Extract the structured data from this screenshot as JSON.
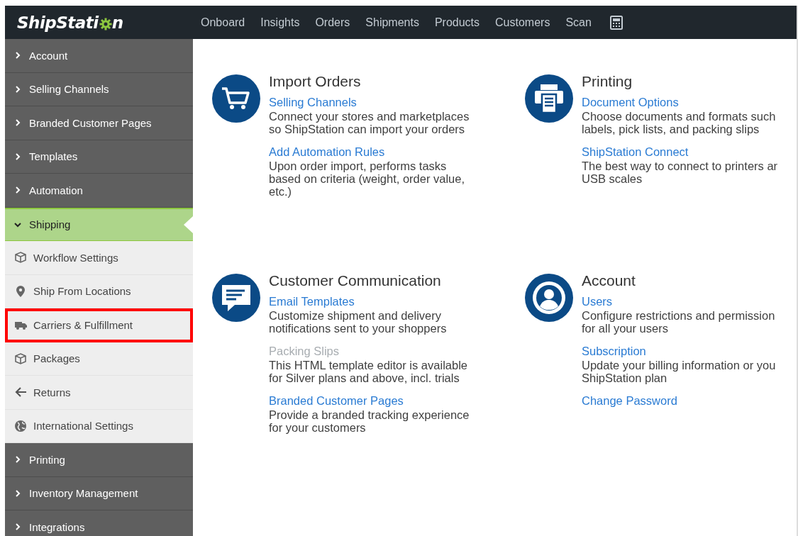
{
  "topbar": {
    "logo": {
      "before_gear": "ShipStati",
      "after_gear": "n"
    },
    "nav": [
      {
        "label": "Onboard"
      },
      {
        "label": "Insights"
      },
      {
        "label": "Orders"
      },
      {
        "label": "Shipments"
      },
      {
        "label": "Products"
      },
      {
        "label": "Customers"
      },
      {
        "label": "Scan"
      }
    ]
  },
  "sidebar": {
    "items": [
      {
        "label": "Account",
        "expanded": false
      },
      {
        "label": "Selling Channels",
        "expanded": false
      },
      {
        "label": "Branded Customer Pages",
        "expanded": false
      },
      {
        "label": "Templates",
        "expanded": false
      },
      {
        "label": "Automation",
        "expanded": false
      },
      {
        "label": "Shipping",
        "expanded": true,
        "children": [
          {
            "label": "Workflow Settings",
            "highlighted": false
          },
          {
            "label": "Ship From Locations",
            "highlighted": false
          },
          {
            "label": "Carriers & Fulfillment",
            "highlighted": true
          },
          {
            "label": "Packages",
            "highlighted": false
          },
          {
            "label": "Returns",
            "highlighted": false
          },
          {
            "label": "International Settings",
            "highlighted": false
          }
        ]
      },
      {
        "label": "Printing",
        "expanded": false
      },
      {
        "label": "Inventory Management",
        "expanded": false
      },
      {
        "label": "Integrations",
        "expanded": false
      }
    ]
  },
  "sections": [
    {
      "title": "Import Orders",
      "links": [
        {
          "label": "Selling Channels",
          "disabled": false,
          "description": [
            "Connect your stores and marketplaces",
            "so ShipStation can import your orders"
          ]
        },
        {
          "label": "Add Automation Rules",
          "disabled": false,
          "description": [
            "Upon order import, performs tasks",
            "based on criteria (weight, order value,",
            "etc.)"
          ]
        }
      ]
    },
    {
      "title": "Printing",
      "links": [
        {
          "label": "Document Options",
          "disabled": false,
          "description": [
            "Choose documents and formats such",
            "labels, pick lists, and packing slips"
          ]
        },
        {
          "label": "ShipStation Connect",
          "disabled": false,
          "description": [
            "The best way to connect to printers ar",
            "USB scales"
          ]
        }
      ]
    },
    {
      "title": "Customer Communication",
      "links": [
        {
          "label": "Email Templates",
          "disabled": false,
          "description": [
            "Customize shipment and delivery",
            "notifications sent to your shoppers"
          ]
        },
        {
          "label": "Packing Slips",
          "disabled": true,
          "description": [
            "This HTML template editor is available",
            "for Silver plans and above, incl. trials"
          ]
        },
        {
          "label": "Branded Customer Pages",
          "disabled": false,
          "description": [
            "Provide a branded tracking experience",
            "for your customers"
          ]
        }
      ]
    },
    {
      "title": "Account",
      "links": [
        {
          "label": "Users",
          "disabled": false,
          "description": [
            "Configure restrictions and permission",
            "for all your users"
          ]
        },
        {
          "label": "Subscription",
          "disabled": false,
          "description": [
            "Update your billing information or you",
            "ShipStation plan"
          ]
        },
        {
          "label": "Change Password",
          "disabled": false
        }
      ]
    }
  ]
}
